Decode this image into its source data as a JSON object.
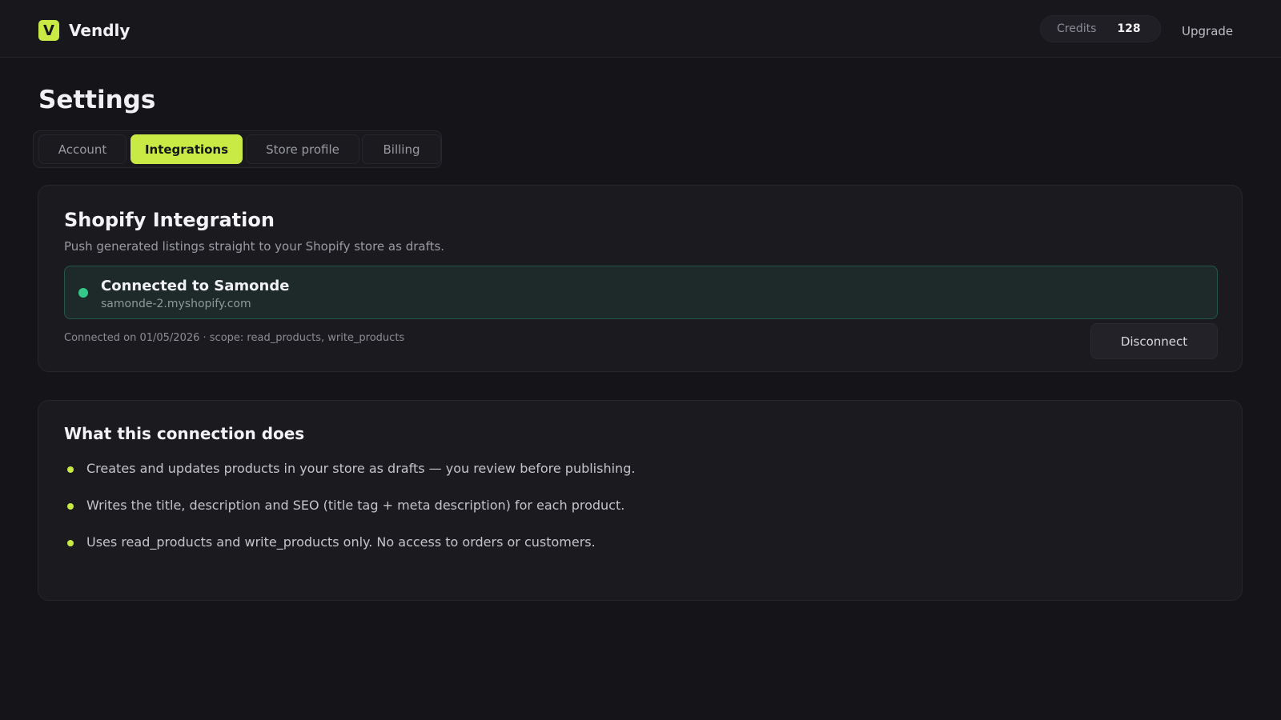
{
  "app": {
    "logo_letter": "V",
    "name": "Vendly"
  },
  "header": {
    "credits_label": "Credits",
    "credits_value": "128",
    "upgrade_label": "Upgrade"
  },
  "page": {
    "title": "Settings"
  },
  "tabs": [
    {
      "label": "Account",
      "active": false
    },
    {
      "label": "Integrations",
      "active": true
    },
    {
      "label": "Store profile",
      "active": false
    },
    {
      "label": "Billing",
      "active": false
    }
  ],
  "shopify": {
    "title": "Shopify Integration",
    "subtitle": "Push generated listings straight to your Shopify store as drafts.",
    "status": {
      "title": "Connected to Samonde",
      "domain": "samonde-2.myshopify.com",
      "color": "#34c98a"
    },
    "meta": "Connected on 01/05/2026 · scope: read_products, write_products",
    "disconnect_label": "Disconnect"
  },
  "info": {
    "title": "What this connection does",
    "items": [
      "Creates and updates products in your store as drafts — you review before publishing.",
      "Writes the title, description and SEO (title tag + meta description) for each product.",
      "Uses read_products and write_products only. No access to orders or customers."
    ]
  },
  "colors": {
    "accent": "#c9ea45",
    "background": "#141419",
    "card": "#1a1a1f",
    "success": "#34c98a"
  }
}
